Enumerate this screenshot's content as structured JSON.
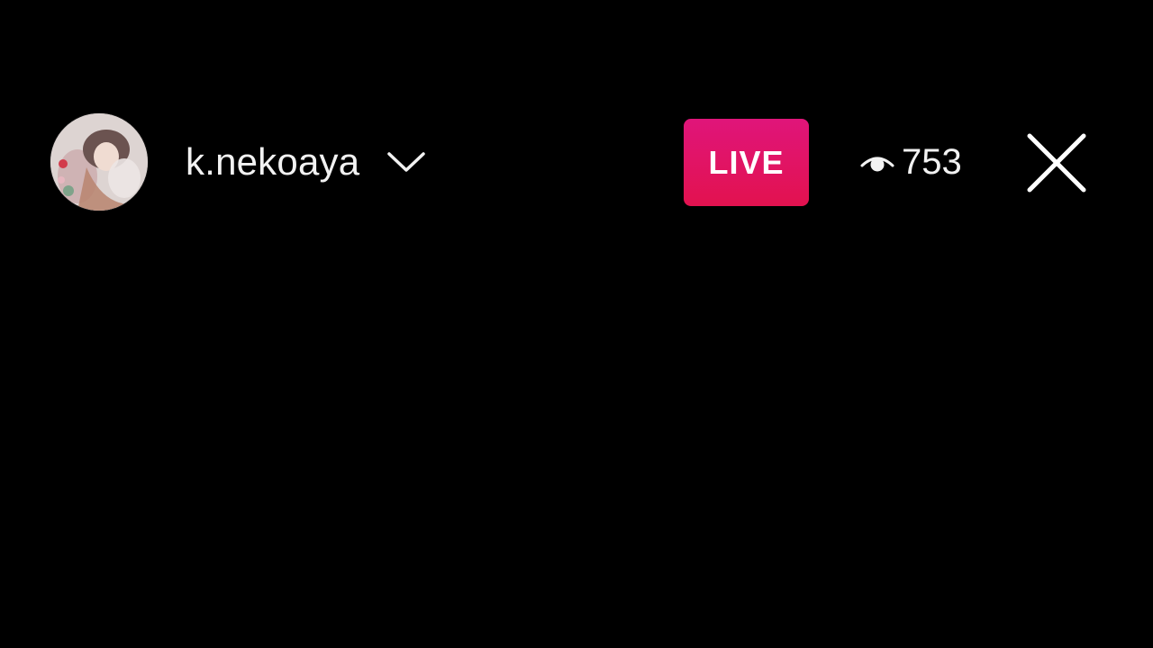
{
  "header": {
    "username": "k.nekoaya",
    "live_label": "LIVE",
    "viewer_count": "753"
  },
  "icons": {
    "avatar": "profile-photo",
    "username_dropdown": "chevron-down-icon",
    "viewers": "eye-icon",
    "close": "close-icon"
  },
  "colors": {
    "background": "#000000",
    "live_badge": "#e0155f",
    "text": "#f2f2f2"
  }
}
